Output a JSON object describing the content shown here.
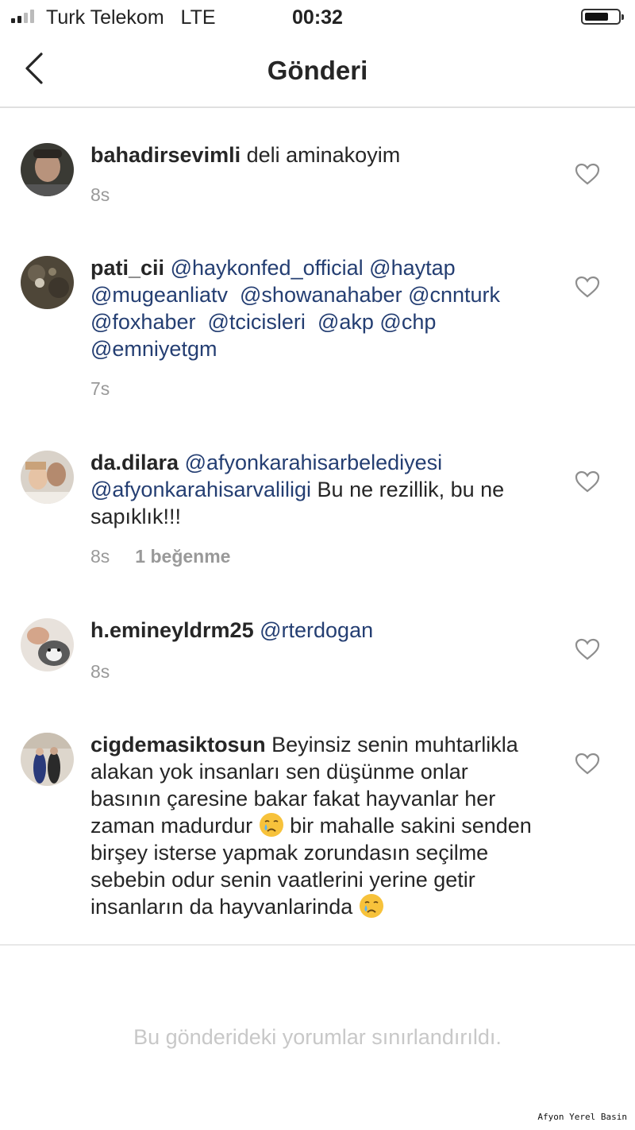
{
  "status_bar": {
    "carrier": "Turk Telekom",
    "network": "LTE",
    "time": "00:32"
  },
  "nav": {
    "title": "Gönderi",
    "back_icon": "chevron-left-icon"
  },
  "comments": [
    {
      "username": "bahadirsevimli",
      "text": "deli aminakoyim",
      "time": "8s"
    },
    {
      "username": "pati_cii",
      "mentions": [
        "@haykonfed_official",
        "@haytap",
        "@mugeanliatv",
        "@showanahaber",
        "@cnnturk",
        "@foxhaber",
        "@tcicisleri",
        "@akp",
        "@chp",
        "@emniyetgm"
      ],
      "time": "7s"
    },
    {
      "username": "da.dilara",
      "mentions": [
        "@afyonkarahisarbelediyesi",
        "@afyonkarahisarvaliligi"
      ],
      "text": "Bu ne rezillik, bu ne sapıklık!!!",
      "time": "8s",
      "likes": "1 beğenme"
    },
    {
      "username": "h.emineyldrm25",
      "mentions": [
        "@rterdogan"
      ],
      "time": "8s"
    },
    {
      "username": "cigdemasiktosun",
      "text_part1": "Beyinsiz senin muhtarlikla alakan yok insanları sen düşünme onlar basının çaresine bakar fakat hayvanlar her zaman madurdur",
      "text_part2": "bir mahalle sakini senden birşey isterse yapmak zorundasın seçilme sebebin odur senin vaatlerini yerine getir insanların da hayvanlarinda",
      "emoji": "crying-face-icon"
    }
  ],
  "footer": {
    "restricted_text": "Bu gönderideki yorumlar sınırlandırıldı."
  },
  "watermark": "Afyon Yerel Basin",
  "colors": {
    "mention": "#243e72",
    "meta": "#999999",
    "text": "#262626"
  }
}
